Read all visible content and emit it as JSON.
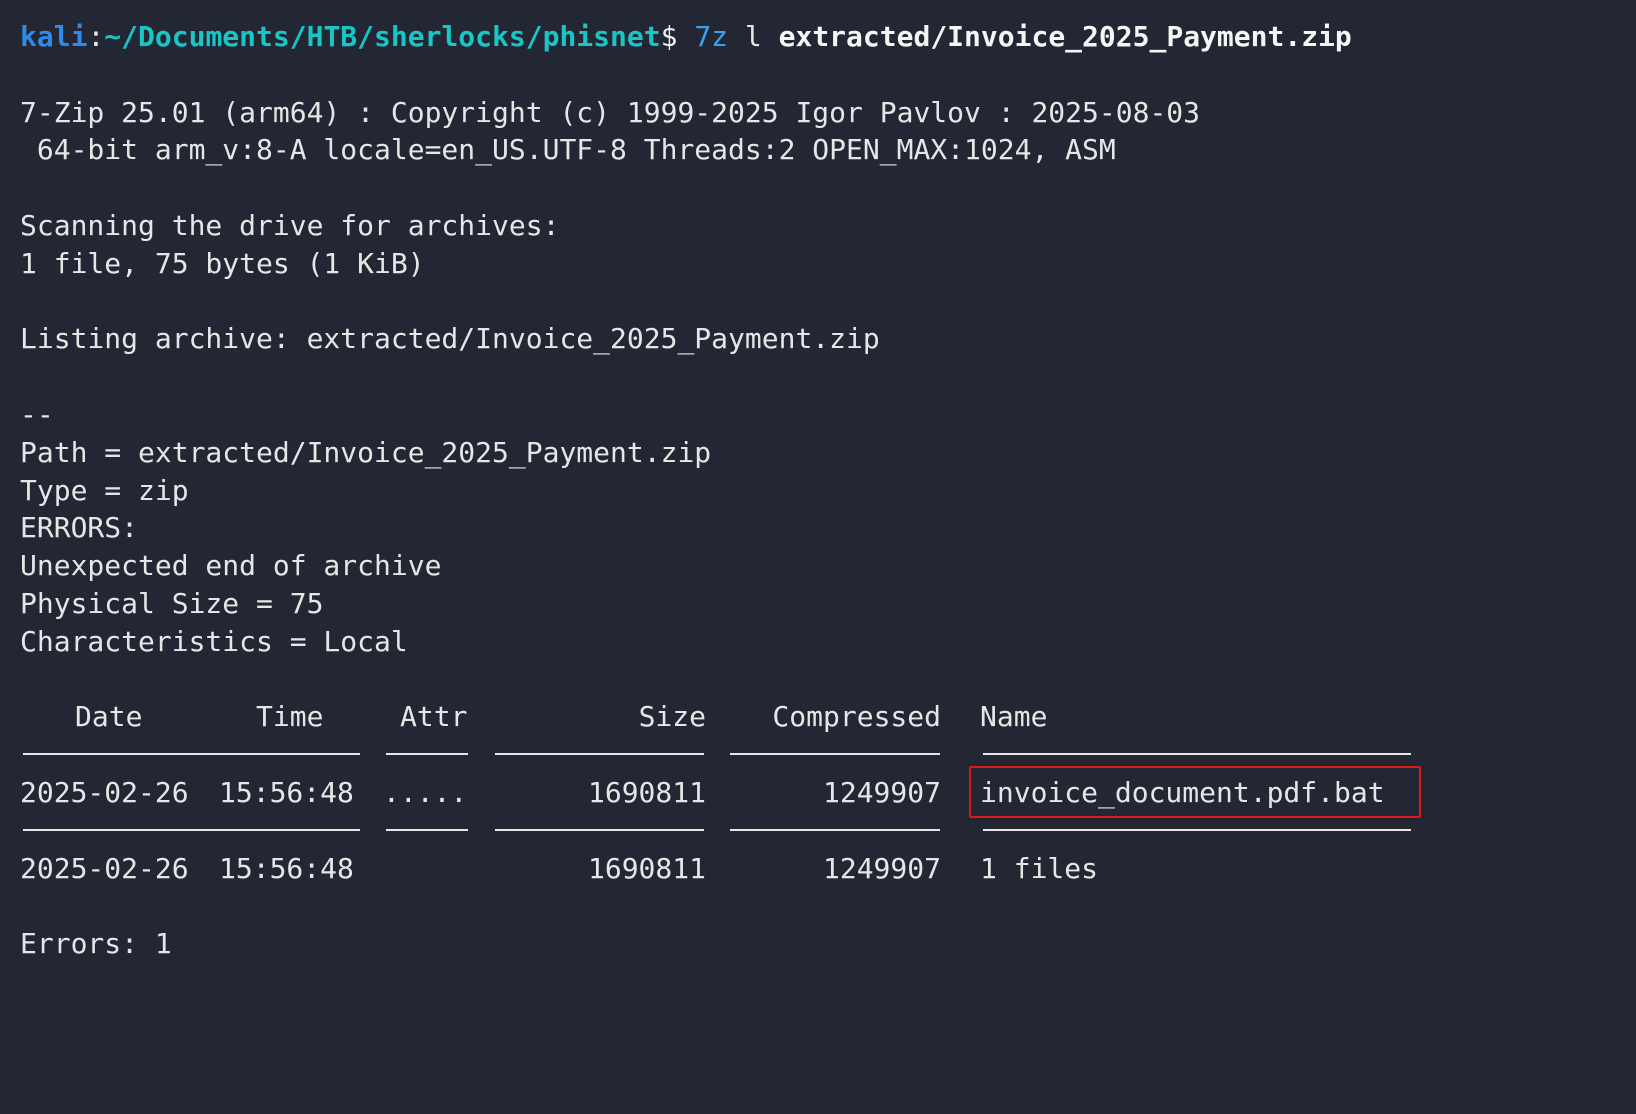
{
  "prompt": {
    "user": "kali",
    "separator": ":",
    "path": "~/Documents/HTB/sherlocks/phisnet",
    "symbol": "$",
    "command": "7z",
    "arg1": "l",
    "arg2": "extracted/Invoice_2025_Payment.zip"
  },
  "header": {
    "line1": "7-Zip 25.01 (arm64) : Copyright (c) 1999-2025 Igor Pavlov : 2025-08-03",
    "line2": " 64-bit arm_v:8-A locale=en_US.UTF-8 Threads:2 OPEN_MAX:1024, ASM"
  },
  "scan": {
    "line1": "Scanning the drive for archives:",
    "line2": "1 file, 75 bytes (1 KiB)"
  },
  "listing": "Listing archive: extracted/Invoice_2025_Payment.zip",
  "separator_dashes": "--",
  "info": {
    "path": "Path = extracted/Invoice_2025_Payment.zip",
    "type": "Type = zip",
    "errors_label": "ERRORS:",
    "error_message": "Unexpected end of archive",
    "physical_size": "Physical Size = 75",
    "characteristics": "Characteristics = Local"
  },
  "table": {
    "headers": {
      "date": "Date",
      "time": "Time",
      "attr": "Attr",
      "size": "Size",
      "compressed": "Compressed",
      "name": "Name"
    },
    "row": {
      "date": "2025-02-26",
      "time": "15:56:48",
      "attr": ".....",
      "size": "1690811",
      "compressed": "1249907",
      "name": "invoice_document.pdf.bat"
    },
    "summary": {
      "date": "2025-02-26",
      "time": "15:56:48",
      "size": "1690811",
      "compressed": "1249907",
      "name": "1 files"
    }
  },
  "errors_footer": "Errors: 1",
  "colors": {
    "background": "#232733",
    "text": "#e6e6e6",
    "user": "#2f8ae8",
    "path": "#19c6c6",
    "command": "#3da2ee",
    "highlight": "#e01818"
  }
}
